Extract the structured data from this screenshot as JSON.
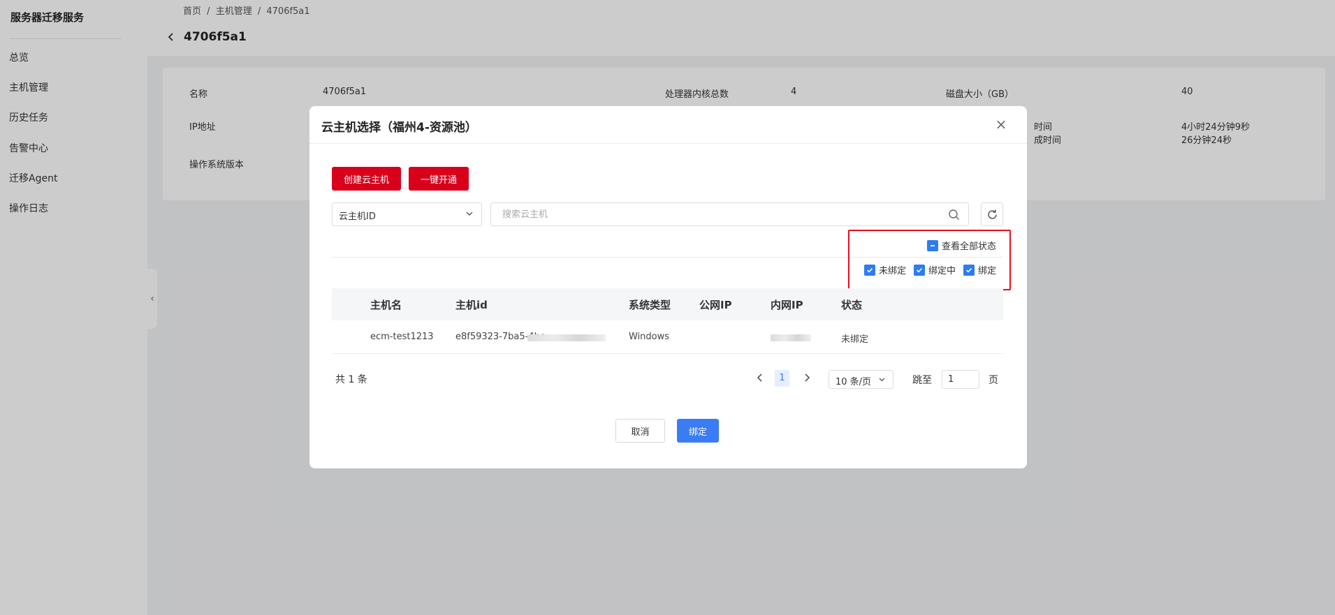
{
  "sidebar": {
    "title": "服务器迁移服务",
    "items": [
      {
        "label": "总览"
      },
      {
        "label": "主机管理"
      },
      {
        "label": "历史任务"
      },
      {
        "label": "告警中心"
      },
      {
        "label": "迁移Agent"
      },
      {
        "label": "操作日志"
      }
    ]
  },
  "header": {
    "breadcrumb": [
      "首页",
      "/",
      "主机管理",
      "/",
      "4706f5a1"
    ],
    "title": "4706f5a1"
  },
  "info": {
    "name_label": "名称",
    "name_value": "4706f5a1",
    "cpu_label": "处理器内核总数",
    "cpu_value": "4",
    "disk_label": "磁盘大小（GB）",
    "disk_value": "40",
    "ip_label": "IP地址",
    "partial_label_1": "时间",
    "partial_label_2": "成时间",
    "time_value_1": "4小时24分钟9秒",
    "time_value_2": "26分钟24秒",
    "os_label": "操作系统版本"
  },
  "modal": {
    "title": "云主机选择（福州4-资源池）",
    "close_glyph": "×",
    "create_button": "创建云主机",
    "open_button": "一键开通",
    "select_value": "云主机ID",
    "search_placeholder": "搜索云主机",
    "filters": {
      "all_label": "查看全部状态",
      "unbound_label": "未绑定",
      "binding_label": "绑定中",
      "bound_label": "绑定"
    },
    "columns": [
      "主机名",
      "主机id",
      "系统类型",
      "公网IP",
      "内网IP",
      "状态"
    ],
    "rows": [
      {
        "hostname": "ecm-test1213",
        "host_id": "e8f59323-7ba5-4bc",
        "os": "Windows",
        "public_ip": "",
        "status": "未绑定"
      }
    ],
    "pagination": {
      "total": "共 1 条",
      "current_page": "1",
      "page_size": "10 条/页",
      "jump_label": "跳至",
      "jump_value": "1",
      "page_suffix": "页"
    },
    "cancel_button": "取消",
    "confirm_button": "绑定"
  },
  "colors": {
    "brand_red": "#d9001b",
    "primary_blue": "#3a7cf5",
    "highlight_red": "#e8101d"
  }
}
